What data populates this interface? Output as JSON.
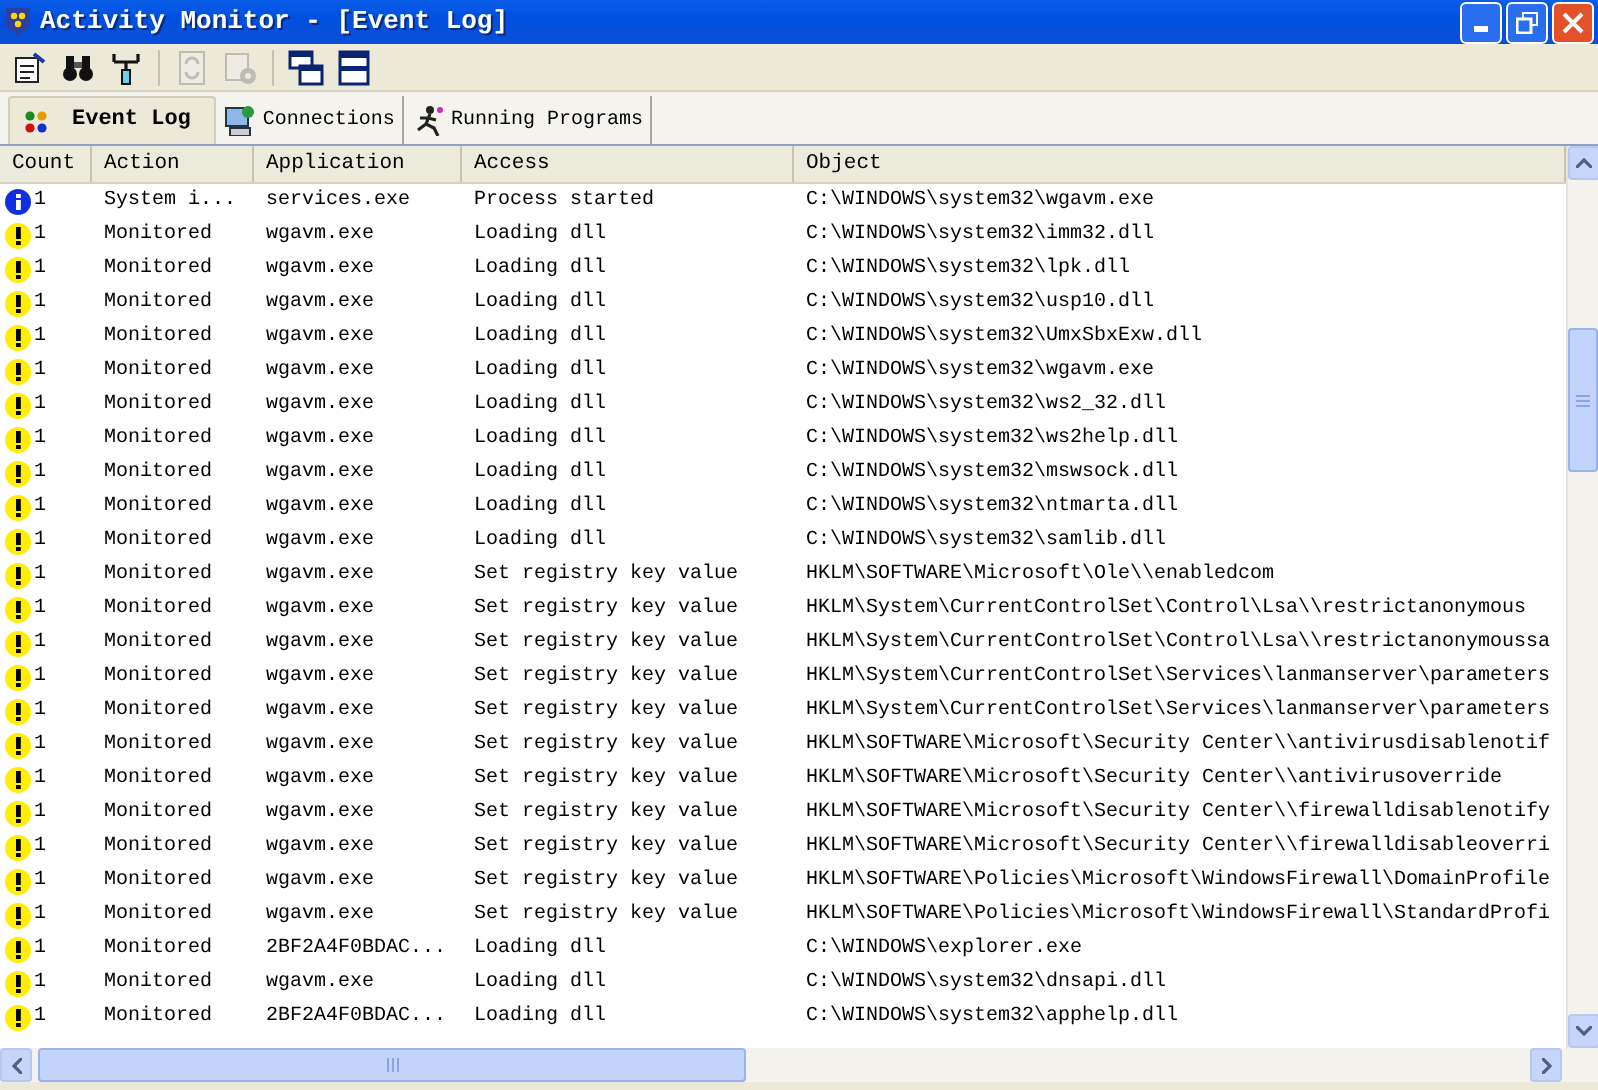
{
  "window": {
    "title": "Activity Monitor - [Event Log]"
  },
  "toolbar": [
    {
      "kind": "properties",
      "disabled": false
    },
    {
      "kind": "find",
      "disabled": false
    },
    {
      "kind": "filter",
      "disabled": false
    },
    {
      "kind": "refresh",
      "disabled": true
    },
    {
      "kind": "settings",
      "disabled": true
    },
    {
      "kind": "cascade",
      "disabled": false
    },
    {
      "kind": "tile",
      "disabled": false
    }
  ],
  "tabs": [
    {
      "label": "Event Log",
      "kind": "events",
      "selected": true
    },
    {
      "label": "Connections",
      "kind": "connections",
      "selected": false
    },
    {
      "label": "Running Programs",
      "kind": "programs",
      "selected": false
    }
  ],
  "table": {
    "columns": [
      "Count",
      "Action",
      "Application",
      "Access",
      "Object"
    ],
    "rows": [
      {
        "kind": "info",
        "count": "1",
        "action": "System i...",
        "application": "services.exe",
        "access": "Process started",
        "object": "C:\\WINDOWS\\system32\\wgavm.exe"
      },
      {
        "kind": "warning",
        "count": "1",
        "action": "Monitored",
        "application": "wgavm.exe",
        "access": "Loading dll",
        "object": "C:\\WINDOWS\\system32\\imm32.dll"
      },
      {
        "kind": "warning",
        "count": "1",
        "action": "Monitored",
        "application": "wgavm.exe",
        "access": "Loading dll",
        "object": "C:\\WINDOWS\\system32\\lpk.dll"
      },
      {
        "kind": "warning",
        "count": "1",
        "action": "Monitored",
        "application": "wgavm.exe",
        "access": "Loading dll",
        "object": "C:\\WINDOWS\\system32\\usp10.dll"
      },
      {
        "kind": "warning",
        "count": "1",
        "action": "Monitored",
        "application": "wgavm.exe",
        "access": "Loading dll",
        "object": "C:\\WINDOWS\\system32\\UmxSbxExw.dll"
      },
      {
        "kind": "warning",
        "count": "1",
        "action": "Monitored",
        "application": "wgavm.exe",
        "access": "Loading dll",
        "object": "C:\\WINDOWS\\system32\\wgavm.exe"
      },
      {
        "kind": "warning",
        "count": "1",
        "action": "Monitored",
        "application": "wgavm.exe",
        "access": "Loading dll",
        "object": "C:\\WINDOWS\\system32\\ws2_32.dll"
      },
      {
        "kind": "warning",
        "count": "1",
        "action": "Monitored",
        "application": "wgavm.exe",
        "access": "Loading dll",
        "object": "C:\\WINDOWS\\system32\\ws2help.dll"
      },
      {
        "kind": "warning",
        "count": "1",
        "action": "Monitored",
        "application": "wgavm.exe",
        "access": "Loading dll",
        "object": "C:\\WINDOWS\\system32\\mswsock.dll"
      },
      {
        "kind": "warning",
        "count": "1",
        "action": "Monitored",
        "application": "wgavm.exe",
        "access": "Loading dll",
        "object": "C:\\WINDOWS\\system32\\ntmarta.dll"
      },
      {
        "kind": "warning",
        "count": "1",
        "action": "Monitored",
        "application": "wgavm.exe",
        "access": "Loading dll",
        "object": "C:\\WINDOWS\\system32\\samlib.dll"
      },
      {
        "kind": "warning",
        "count": "1",
        "action": "Monitored",
        "application": "wgavm.exe",
        "access": "Set registry key value",
        "object": "HKLM\\SOFTWARE\\Microsoft\\Ole\\\\enabledcom"
      },
      {
        "kind": "warning",
        "count": "1",
        "action": "Monitored",
        "application": "wgavm.exe",
        "access": "Set registry key value",
        "object": "HKLM\\System\\CurrentControlSet\\Control\\Lsa\\\\restrictanonymous"
      },
      {
        "kind": "warning",
        "count": "1",
        "action": "Monitored",
        "application": "wgavm.exe",
        "access": "Set registry key value",
        "object": "HKLM\\System\\CurrentControlSet\\Control\\Lsa\\\\restrictanonymoussa"
      },
      {
        "kind": "warning",
        "count": "1",
        "action": "Monitored",
        "application": "wgavm.exe",
        "access": "Set registry key value",
        "object": "HKLM\\System\\CurrentControlSet\\Services\\lanmanserver\\parameters"
      },
      {
        "kind": "warning",
        "count": "1",
        "action": "Monitored",
        "application": "wgavm.exe",
        "access": "Set registry key value",
        "object": "HKLM\\System\\CurrentControlSet\\Services\\lanmanserver\\parameters"
      },
      {
        "kind": "warning",
        "count": "1",
        "action": "Monitored",
        "application": "wgavm.exe",
        "access": "Set registry key value",
        "object": "HKLM\\SOFTWARE\\Microsoft\\Security Center\\\\antivirusdisablenotif"
      },
      {
        "kind": "warning",
        "count": "1",
        "action": "Monitored",
        "application": "wgavm.exe",
        "access": "Set registry key value",
        "object": "HKLM\\SOFTWARE\\Microsoft\\Security Center\\\\antivirusoverride"
      },
      {
        "kind": "warning",
        "count": "1",
        "action": "Monitored",
        "application": "wgavm.exe",
        "access": "Set registry key value",
        "object": "HKLM\\SOFTWARE\\Microsoft\\Security Center\\\\firewalldisablenotify"
      },
      {
        "kind": "warning",
        "count": "1",
        "action": "Monitored",
        "application": "wgavm.exe",
        "access": "Set registry key value",
        "object": "HKLM\\SOFTWARE\\Microsoft\\Security Center\\\\firewalldisableoverri"
      },
      {
        "kind": "warning",
        "count": "1",
        "action": "Monitored",
        "application": "wgavm.exe",
        "access": "Set registry key value",
        "object": "HKLM\\SOFTWARE\\Policies\\Microsoft\\WindowsFirewall\\DomainProfile"
      },
      {
        "kind": "warning",
        "count": "1",
        "action": "Monitored",
        "application": "wgavm.exe",
        "access": "Set registry key value",
        "object": "HKLM\\SOFTWARE\\Policies\\Microsoft\\WindowsFirewall\\StandardProfi"
      },
      {
        "kind": "warning",
        "count": "1",
        "action": "Monitored",
        "application": "2BF2A4F0BDAC...",
        "access": "Loading dll",
        "object": "C:\\WINDOWS\\explorer.exe"
      },
      {
        "kind": "warning",
        "count": "1",
        "action": "Monitored",
        "application": "wgavm.exe",
        "access": "Loading dll",
        "object": "C:\\WINDOWS\\system32\\dnsapi.dll"
      },
      {
        "kind": "warning",
        "count": "1",
        "action": "Monitored",
        "application": "2BF2A4F0BDAC...",
        "access": "Loading dll",
        "object": "C:\\WINDOWS\\system32\\apphelp.dll"
      }
    ]
  }
}
